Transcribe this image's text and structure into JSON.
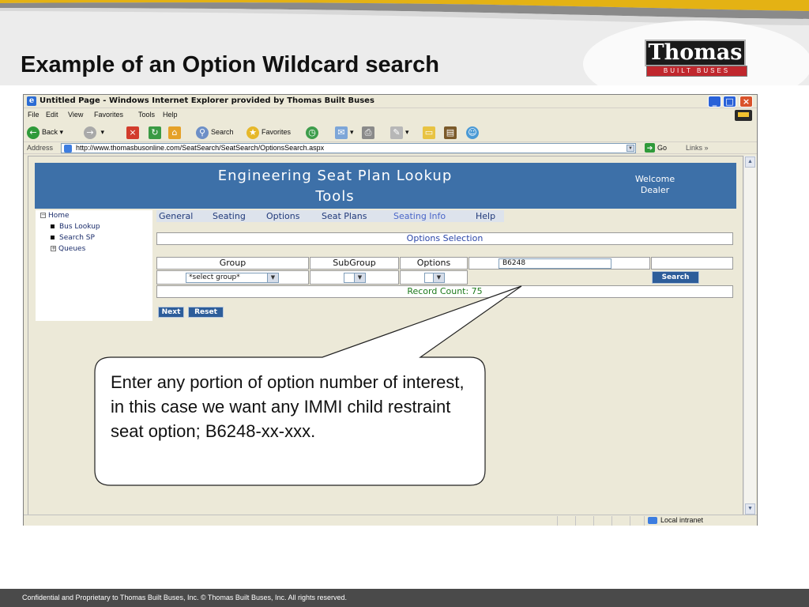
{
  "slide": {
    "title": "Example of an Option Wildcard search",
    "logo_word": "Thomas",
    "logo_sub": "BUILT BUSES",
    "footer": "Confidential and Proprietary to Thomas Built Buses, Inc.  © Thomas Built Buses, Inc.  All rights reserved."
  },
  "browser": {
    "title": "Untitled Page - Windows Internet Explorer provided by Thomas Built Buses",
    "menu": [
      "File",
      "Edit",
      "View",
      "Favorites",
      "Tools",
      "Help"
    ],
    "toolbar": {
      "back": "Back",
      "search": "Search",
      "favorites": "Favorites"
    },
    "address_label": "Address",
    "url": "http://www.thomasbusonline.com/SeatSearch/SeatSearch/OptionsSearch.aspx",
    "go": "Go",
    "links": "Links",
    "status_zone": "Local intranet"
  },
  "page": {
    "banner_title_1": "Engineering  Seat  Plan  Lookup",
    "banner_title_2": "Tools",
    "welcome_1": "Welcome",
    "welcome_2": "Dealer",
    "nav": {
      "home": "Home",
      "bus_lookup": "Bus Lookup",
      "search_sp": "Search SP",
      "queues": "Queues"
    },
    "menu": {
      "general": "General",
      "seating": "Seating",
      "options": "Options",
      "seat_plans": "Seat Plans",
      "seating_info": "Seating Info",
      "help": "Help"
    },
    "options_selection": "Options Selection",
    "columns": {
      "group": "Group",
      "subgroup": "SubGroup",
      "options": "Options",
      "search": "Search"
    },
    "group_select": "*select group*",
    "search_value": "B6248",
    "search_button": "Search",
    "record_count": "Record Count: 75",
    "next_button": "Next",
    "reset_button": "Reset"
  },
  "callout": {
    "text": "Enter any portion of option number of interest, in this case we want any IMMI child restraint seat option; B6248-xx-xxx."
  },
  "colors": {
    "banner": "#3d70a8",
    "record_count": "#1d7a1d",
    "button": "#2d5d9a",
    "link_active": "#4a66c8"
  }
}
